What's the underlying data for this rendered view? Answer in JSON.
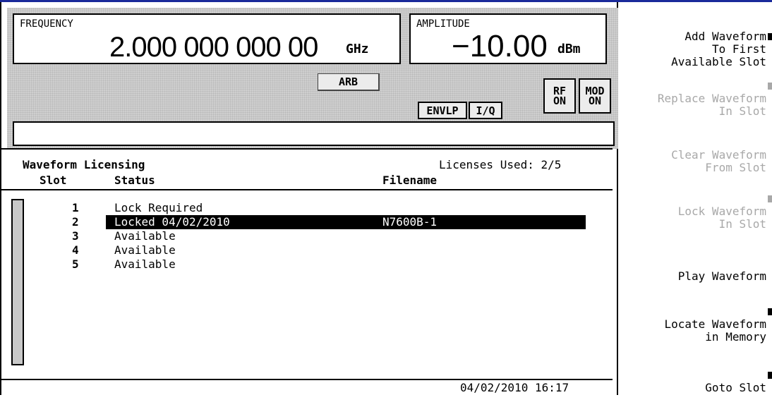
{
  "status": {
    "frequency_label": "FREQUENCY",
    "frequency_value": "2.000 000 000 00",
    "frequency_unit": "GHz",
    "amplitude_label": "AMPLITUDE",
    "amplitude_value": "−10.00",
    "amplitude_unit": "dBm",
    "indicators": {
      "arb": "ARB",
      "envlp": "ENVLP",
      "iq": "I/Q",
      "rf_on_1": "RF",
      "rf_on_2": "ON",
      "mod_on_1": "MOD",
      "mod_on_2": "ON"
    },
    "message": ""
  },
  "licensing": {
    "title": "Waveform Licensing",
    "licenses_used": "Licenses Used: 2/5",
    "columns": {
      "slot": "Slot",
      "status": "Status",
      "filename": "Filename"
    },
    "rows": [
      {
        "slot": "1",
        "status": "Lock Required",
        "filename": ""
      },
      {
        "slot": "2",
        "status": "Locked 04/02/2010",
        "filename": "N7600B-1"
      },
      {
        "slot": "3",
        "status": "Available",
        "filename": ""
      },
      {
        "slot": "4",
        "status": "Available",
        "filename": ""
      },
      {
        "slot": "5",
        "status": "Available",
        "filename": ""
      }
    ],
    "selected_row": 2,
    "datetime": "04/02/2010 16:17"
  },
  "softkeys": [
    {
      "label": "Add Waveform\nTo First\nAvailable Slot",
      "enabled": true,
      "arrow": true
    },
    {
      "label": "Replace Waveform\nIn Slot",
      "enabled": false,
      "arrow": true
    },
    {
      "label": "Clear Waveform\nFrom Slot",
      "enabled": false,
      "arrow": false
    },
    {
      "label": "Lock Waveform\nIn Slot",
      "enabled": false,
      "arrow": true
    },
    {
      "label": "Play Waveform",
      "enabled": true,
      "arrow": false
    },
    {
      "label": "Locate Waveform\nin Memory",
      "enabled": true,
      "arrow": true
    },
    {
      "label": "Goto Slot",
      "enabled": true,
      "arrow": true
    }
  ],
  "colors": {
    "frame_accent": "#1a2a9a",
    "disabled_text": "#a8a8a8",
    "selection_bg": "#000000"
  }
}
